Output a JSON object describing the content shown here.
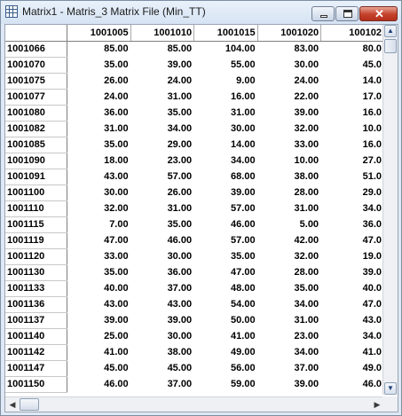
{
  "window": {
    "title": "Matrix1 - Matris_3 Matrix File (Min_TT)",
    "icon": "grid-icon",
    "controls": {
      "minimize": "minimize-icon",
      "maximize": "maximize-icon",
      "close": "✕"
    }
  },
  "grid": {
    "columns": [
      "1001005",
      "1001010",
      "1001015",
      "1001020",
      "100102"
    ],
    "rows": [
      {
        "id": "1001066",
        "values": [
          "85.00",
          "85.00",
          "104.00",
          "83.00",
          "80.0"
        ]
      },
      {
        "id": "1001070",
        "values": [
          "35.00",
          "39.00",
          "55.00",
          "30.00",
          "45.0"
        ]
      },
      {
        "id": "1001075",
        "values": [
          "26.00",
          "24.00",
          "9.00",
          "24.00",
          "14.0"
        ]
      },
      {
        "id": "1001077",
        "values": [
          "24.00",
          "31.00",
          "16.00",
          "22.00",
          "17.0"
        ]
      },
      {
        "id": "1001080",
        "values": [
          "36.00",
          "35.00",
          "31.00",
          "39.00",
          "16.0"
        ]
      },
      {
        "id": "1001082",
        "values": [
          "31.00",
          "34.00",
          "30.00",
          "32.00",
          "10.0"
        ]
      },
      {
        "id": "1001085",
        "values": [
          "35.00",
          "29.00",
          "14.00",
          "33.00",
          "16.0"
        ]
      },
      {
        "id": "1001090",
        "values": [
          "18.00",
          "23.00",
          "34.00",
          "10.00",
          "27.0"
        ]
      },
      {
        "id": "1001091",
        "values": [
          "43.00",
          "57.00",
          "68.00",
          "38.00",
          "51.0"
        ]
      },
      {
        "id": "1001100",
        "values": [
          "30.00",
          "26.00",
          "39.00",
          "28.00",
          "29.0"
        ]
      },
      {
        "id": "1001110",
        "values": [
          "32.00",
          "31.00",
          "57.00",
          "31.00",
          "34.0"
        ]
      },
      {
        "id": "1001115",
        "values": [
          "7.00",
          "35.00",
          "46.00",
          "5.00",
          "36.0"
        ]
      },
      {
        "id": "1001119",
        "values": [
          "47.00",
          "46.00",
          "57.00",
          "42.00",
          "47.0"
        ]
      },
      {
        "id": "1001120",
        "values": [
          "33.00",
          "30.00",
          "35.00",
          "32.00",
          "19.0"
        ]
      },
      {
        "id": "1001130",
        "values": [
          "35.00",
          "36.00",
          "47.00",
          "28.00",
          "39.0"
        ]
      },
      {
        "id": "1001133",
        "values": [
          "40.00",
          "37.00",
          "48.00",
          "35.00",
          "40.0"
        ]
      },
      {
        "id": "1001136",
        "values": [
          "43.00",
          "43.00",
          "54.00",
          "34.00",
          "47.0"
        ]
      },
      {
        "id": "1001137",
        "values": [
          "39.00",
          "39.00",
          "50.00",
          "31.00",
          "43.0"
        ]
      },
      {
        "id": "1001140",
        "values": [
          "25.00",
          "30.00",
          "41.00",
          "23.00",
          "34.0"
        ]
      },
      {
        "id": "1001142",
        "values": [
          "41.00",
          "38.00",
          "49.00",
          "34.00",
          "41.0"
        ]
      },
      {
        "id": "1001147",
        "values": [
          "45.00",
          "45.00",
          "56.00",
          "37.00",
          "49.0"
        ]
      },
      {
        "id": "1001150",
        "values": [
          "46.00",
          "37.00",
          "59.00",
          "39.00",
          "46.0"
        ]
      }
    ]
  },
  "scrollbars": {
    "up": "▲",
    "down": "▼",
    "left": "◀",
    "right": "▶"
  }
}
